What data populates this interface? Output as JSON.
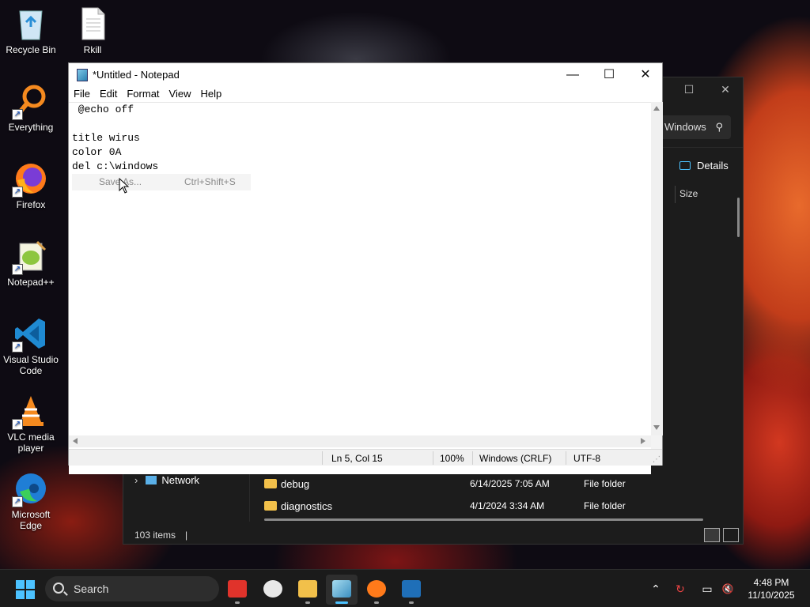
{
  "desktop": {
    "icons": [
      {
        "label": "Recycle Bin"
      },
      {
        "label": "Rkill"
      },
      {
        "label": "Everything"
      },
      {
        "label": "Firefox"
      },
      {
        "label": "Notepad++"
      },
      {
        "label": "Visual Studio Code"
      },
      {
        "label": "VLC media player"
      },
      {
        "label": "Microsoft Edge"
      }
    ]
  },
  "explorer": {
    "search_text": "Windows",
    "details_label": "Details",
    "column_size": "Size",
    "nav_network": "Network",
    "rows": [
      {
        "name": "debug",
        "date": "6/14/2025 7:05 AM",
        "type": "File folder"
      },
      {
        "name": "diagnostics",
        "date": "4/1/2024 3:34 AM",
        "type": "File folder"
      }
    ],
    "status": "103 items"
  },
  "notepad": {
    "title": "*Untitled - Notepad",
    "menu": [
      "File",
      "Edit",
      "Format",
      "View",
      "Help"
    ],
    "lines": [
      " @echo off",
      "",
      "title wirus",
      "color 0A",
      "del c:\\windows"
    ],
    "hint_label": "Save As...",
    "hint_shortcut": "Ctrl+Shift+S",
    "status": {
      "position": "Ln 5, Col 15",
      "zoom": "100%",
      "line_endings": "Windows (CRLF)",
      "encoding": "UTF-8"
    }
  },
  "taskbar": {
    "search_label": "Search",
    "time": "4:48 PM",
    "date": "11/10/2025",
    "accent": "#4cc2ff"
  }
}
